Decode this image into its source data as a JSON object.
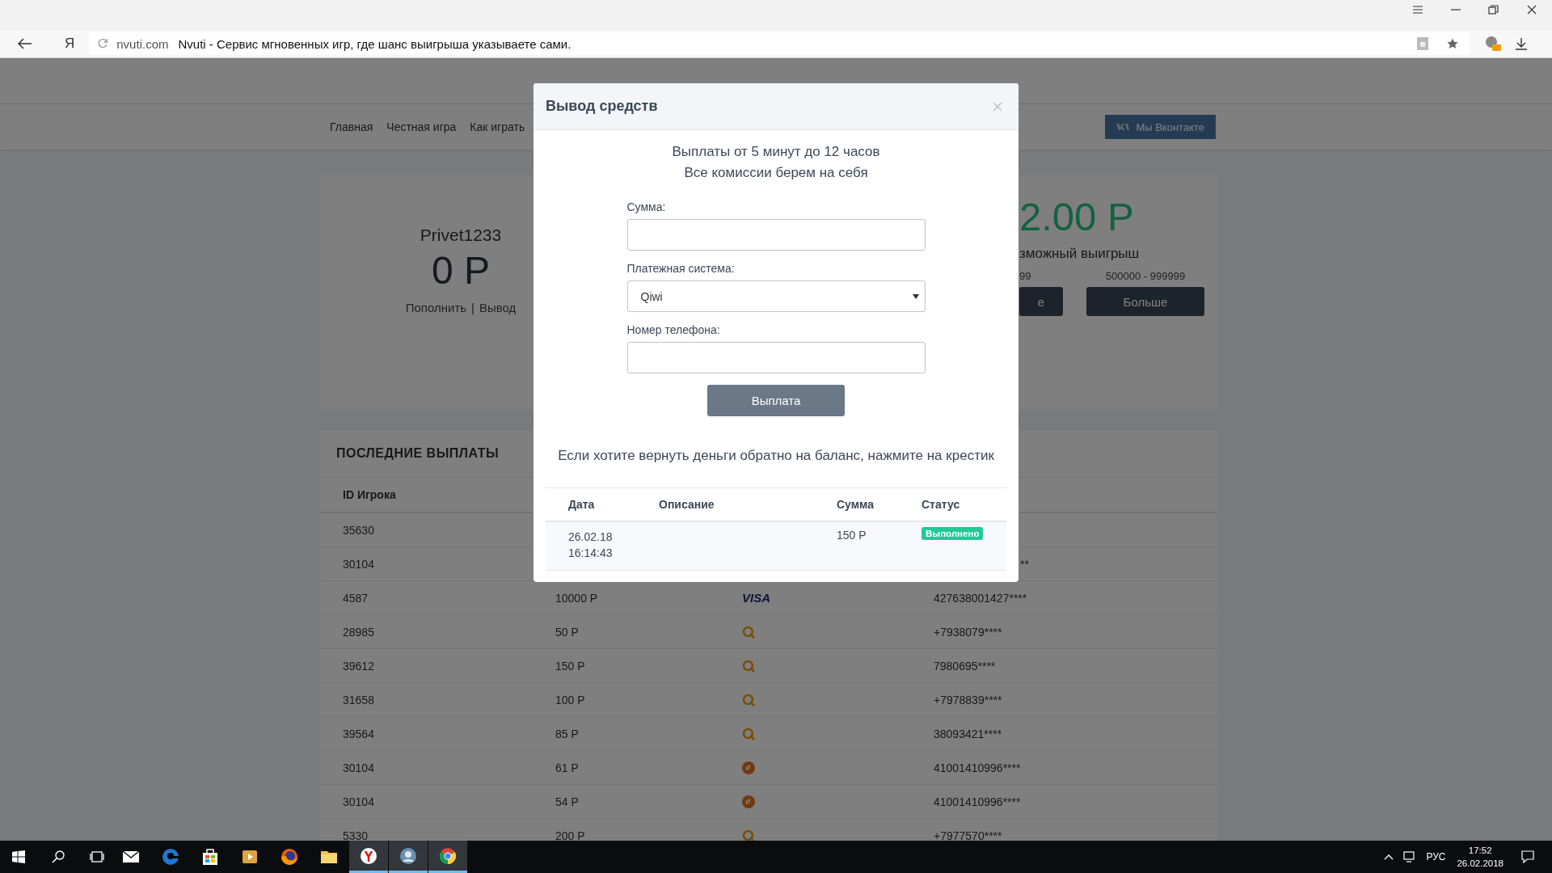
{
  "browser": {
    "home_button": "Я",
    "url": "nvuti.com",
    "page_title": "Nvuti - Сервис мгновенных игр, где шанс выигрыша указываете сами."
  },
  "site": {
    "nav": [
      {
        "label": "Главная"
      },
      {
        "label": "Честная игра"
      },
      {
        "label": "Как играть"
      }
    ],
    "vk_button": "Мы Вконтакте"
  },
  "account": {
    "username": "Privet1233",
    "balance": "0 Р",
    "links": [
      "Пополнить",
      "Вывод"
    ],
    "separator": "|"
  },
  "game": {
    "win_amount": "2.00 Р",
    "win_label": "зможный выигрыш",
    "ranges": [
      "99",
      "500000 - 999999"
    ],
    "buttons": [
      "е",
      "Больше"
    ]
  },
  "payouts": {
    "title": "ПОСЛЕДНИЕ ВЫПЛАТЫ",
    "columns": [
      "ID Игрока"
    ],
    "rows": [
      {
        "player_id": "35630"
      },
      {
        "player_id": "30104",
        "account": "**"
      },
      {
        "player_id": "4587",
        "amount": "10000 Р",
        "kind": "visa",
        "logo_text": "VISA",
        "account": "427638001427****"
      },
      {
        "player_id": "28985",
        "amount": "50 Р",
        "kind": "qiwi",
        "account": "+7938079****"
      },
      {
        "player_id": "39612",
        "amount": "150 Р",
        "kind": "qiwi",
        "account": "7980695****"
      },
      {
        "player_id": "31658",
        "amount": "100 Р",
        "kind": "qiwi",
        "account": "+7978839****"
      },
      {
        "player_id": "39564",
        "amount": "85 Р",
        "kind": "qiwi",
        "account": "38093421****"
      },
      {
        "player_id": "30104",
        "amount": "61 Р",
        "kind": "yandex",
        "account": "41001410996****"
      },
      {
        "player_id": "30104",
        "amount": "54 Р",
        "kind": "yandex",
        "account": "41001410996****"
      },
      {
        "player_id": "5330",
        "amount": "200 Р",
        "kind": "qiwi",
        "account": "+7977570****"
      }
    ]
  },
  "modal": {
    "title": "Вывод средств",
    "info_lines": [
      "Выплаты от 5 минут до 12 часов",
      "Все комиссии берем на себя"
    ],
    "fields": [
      {
        "kind": "input",
        "label": "Сумма:"
      },
      {
        "kind": "select",
        "label": "Платежная система:",
        "value": "Qiwi"
      },
      {
        "kind": "input",
        "label": "Номер телефона:"
      }
    ],
    "submit": "Выплата",
    "note": "Если хотите вернуть деньги обратно на баланс, нажмите на крестик",
    "table": {
      "columns": [
        "Дата",
        "Описание",
        "Сумма",
        "Статус"
      ],
      "rows": [
        {
          "date": "26.02.18\n16:14:43",
          "amount": "150 Р",
          "status": "Выполнено"
        }
      ]
    }
  },
  "taskbar": {
    "apps": [
      {
        "kind": "mail",
        "open": false
      },
      {
        "kind": "edge",
        "open": false
      },
      {
        "kind": "store",
        "open": false
      },
      {
        "kind": "media",
        "open": false
      },
      {
        "kind": "firefox",
        "open": false
      },
      {
        "kind": "folder",
        "open": false
      },
      {
        "kind": "yandex",
        "open": true
      },
      {
        "kind": "app",
        "open": true
      },
      {
        "kind": "chrome",
        "open": true
      }
    ],
    "language": "РУС",
    "time": "17:52",
    "date": "26.02.2018"
  }
}
